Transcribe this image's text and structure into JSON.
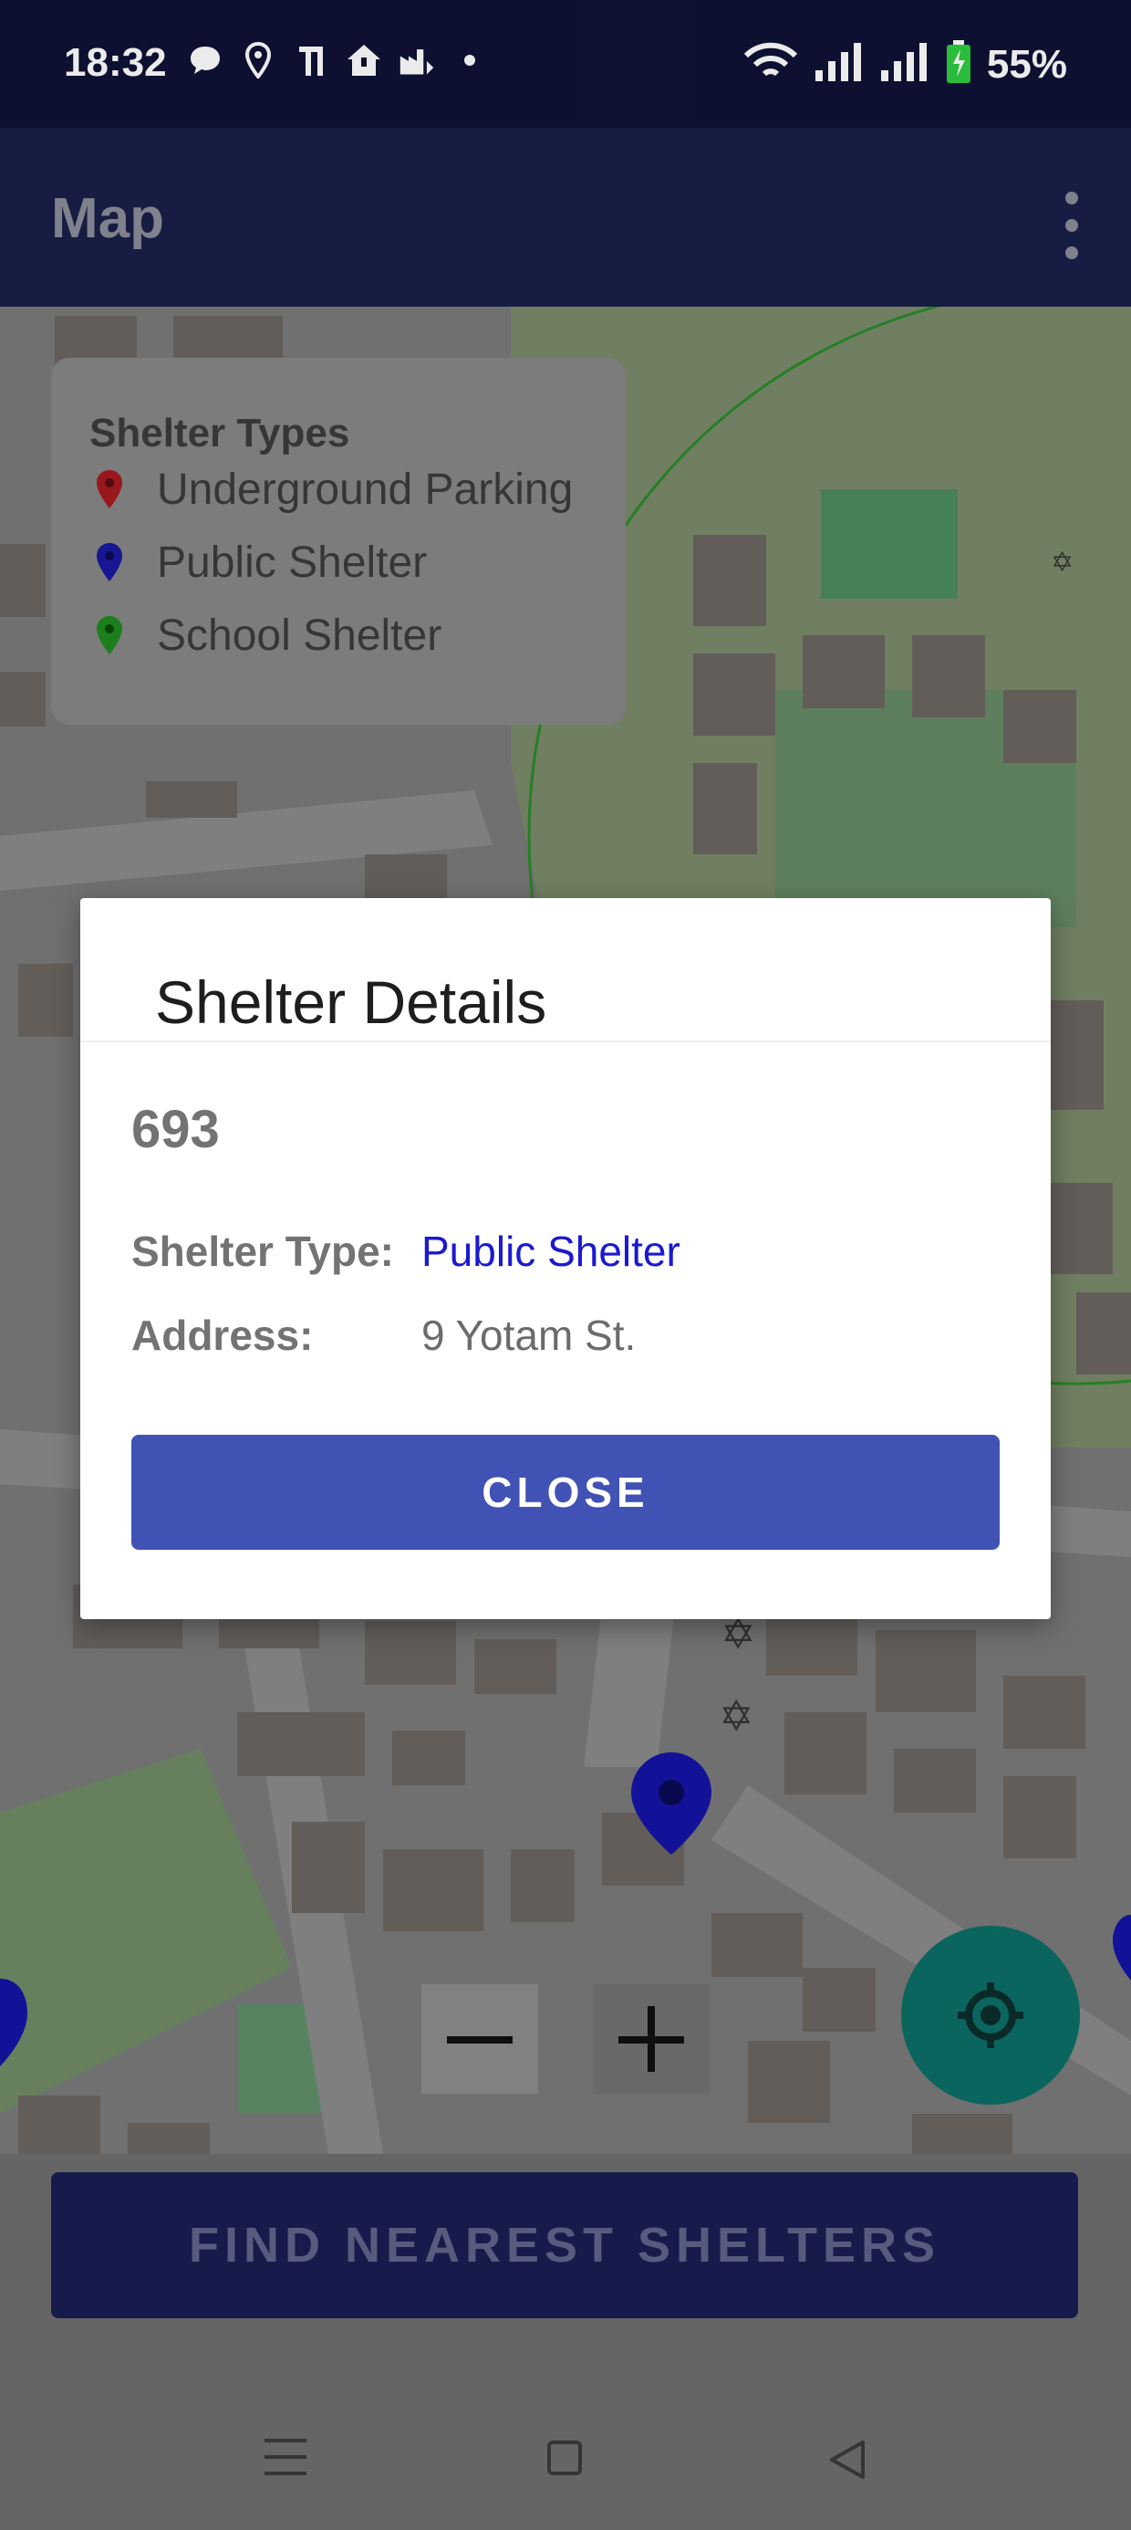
{
  "status_bar": {
    "time": "18:32",
    "battery_percent": "55%",
    "icons_left": [
      "chat-bubble-icon",
      "location-pin-icon",
      "tv-icon",
      "home-alert-icon",
      "factory-icon",
      "dot-icon"
    ],
    "icons_right": [
      "wifi-icon",
      "signal-icon",
      "signal-icon",
      "battery-charging-icon"
    ]
  },
  "app_bar": {
    "title": "Map",
    "menu_icon": "more-vert-icon"
  },
  "legend": {
    "title": "Shelter Types",
    "items": [
      {
        "label": "Underground Parking",
        "color": "#c4161c"
      },
      {
        "label": "Public Shelter",
        "color": "#1a1aa8"
      },
      {
        "label": "School Shelter",
        "color": "#1f9a1f"
      }
    ]
  },
  "dialog": {
    "title": "Shelter Details",
    "shelter_id": "693",
    "type_label": "Shelter Type:",
    "type_value": "Public Shelter",
    "type_value_color": "#1a1ad0",
    "address_label": "Address:",
    "address_value": "9 Yotam St.",
    "close_label": "CLOSE"
  },
  "map_controls": {
    "zoom_out_icon": "minus-icon",
    "zoom_in_icon": "plus-icon",
    "locate_icon": "gps-fixed-icon"
  },
  "find_button": {
    "label": "FIND NEAREST SHELTERS"
  },
  "nav_bar": {
    "icons": [
      "menu-icon",
      "home-icon",
      "back-icon"
    ]
  },
  "colors": {
    "primary": "#1a237e",
    "accent": "#4152b5",
    "fab": "#009688"
  }
}
